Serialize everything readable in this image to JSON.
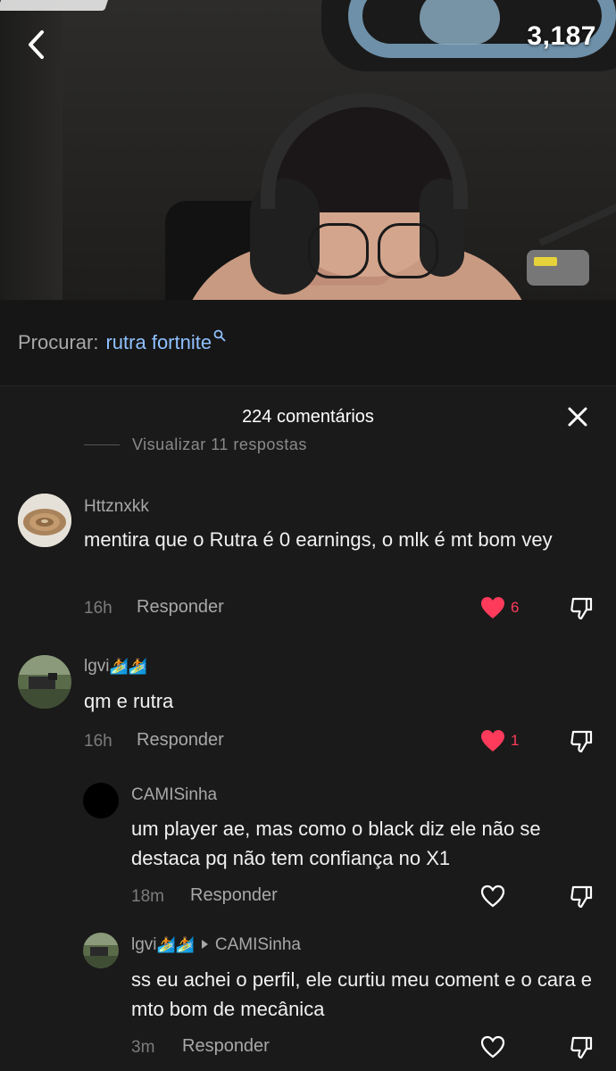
{
  "video": {
    "view_count": "3,187"
  },
  "search": {
    "prefix": "Procurar:",
    "query": "rutra fortnite"
  },
  "comments_panel": {
    "title": "224 comentários",
    "partial_replies_label": "Visualizar 11 respostas"
  },
  "comments": [
    {
      "username": "Httznxkk",
      "text": "mentira que o Rutra é 0 earnings, o mlk é mt bom vey",
      "time": "16h",
      "reply_label": "Responder",
      "likes": "6",
      "liked": true
    },
    {
      "username": "lgvi",
      "username_emoji": "🏄🏄",
      "text": "qm e rutra",
      "time": "16h",
      "reply_label": "Responder",
      "likes": "1",
      "liked": true
    },
    {
      "username": "CAMISinha",
      "text": "um player ae, mas como o black diz ele não se destaca pq não tem confiança no X1",
      "time": "18m",
      "reply_label": "Responder",
      "likes": "",
      "liked": false
    },
    {
      "username": "lgvi",
      "username_emoji": "🏄🏄",
      "reply_to": "CAMISinha",
      "text": "ss eu achei o perfil, ele curtiu meu coment e o cara e mto bom de mecânica",
      "time": "3m",
      "reply_label": "Responder",
      "likes": "",
      "liked": false
    }
  ],
  "colors": {
    "background": "#1a1a1a",
    "link_blue": "#8fc0ff",
    "like_red": "#ff3b5c",
    "muted_text": "#a8a8a8"
  }
}
